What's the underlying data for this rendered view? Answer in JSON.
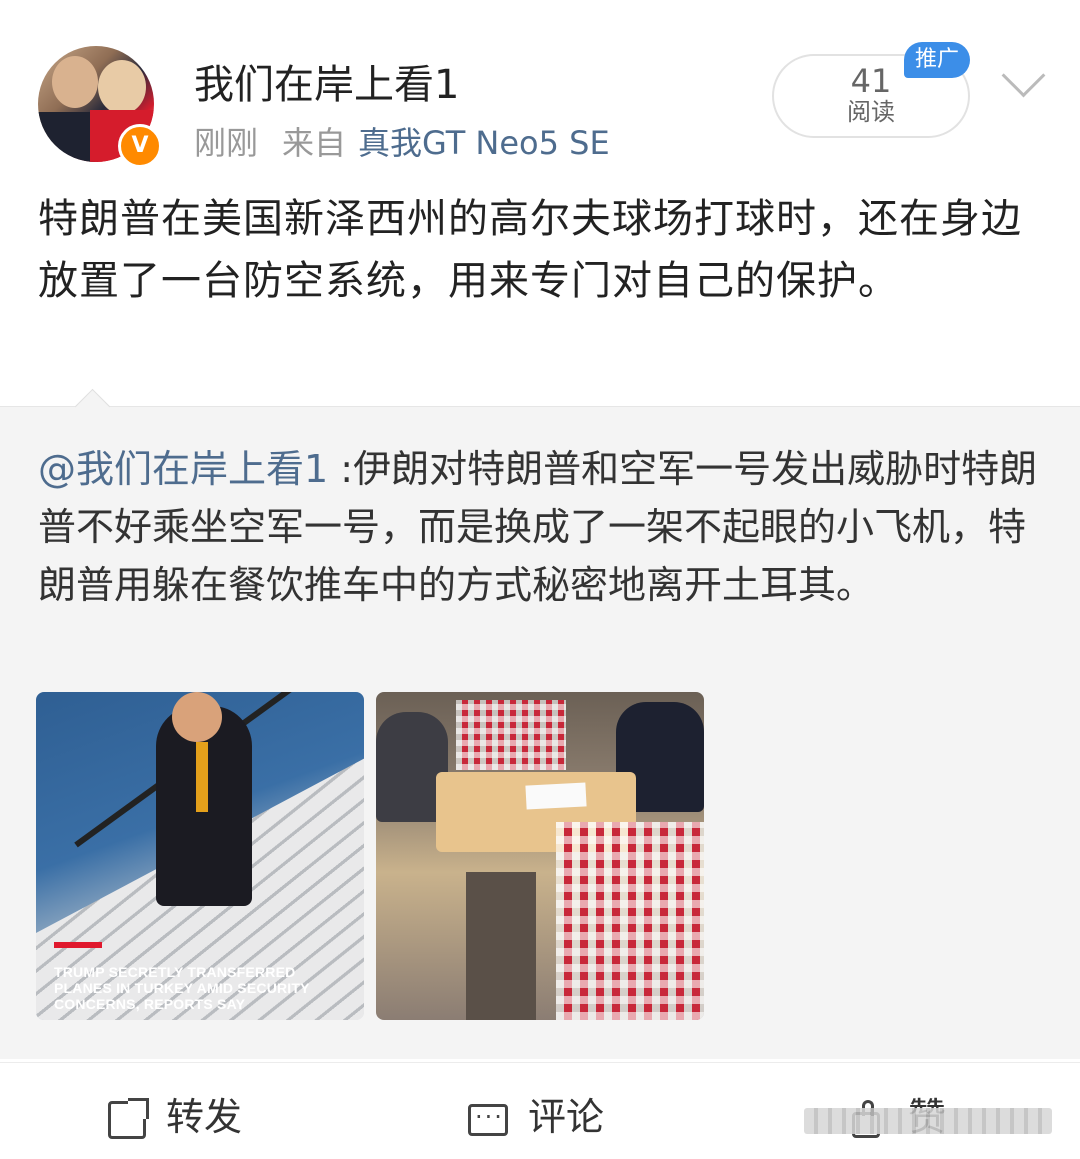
{
  "post": {
    "username": "我们在岸上看1",
    "time": "刚刚",
    "source_prefix": "来自",
    "device": "真我GT Neo5 SE",
    "read_count": "41",
    "read_label": "阅读",
    "promo_badge": "推广",
    "text": "特朗普在美国新泽西州的高尔夫球场打球时，还在身边放置了一台防空系统，用来专门对自己的保护。"
  },
  "repost": {
    "mention": "@我们在岸上看1",
    "text": " :伊朗对特朗普和空军一号发出威胁时特朗普不好乘坐空军一号，而是换成了一架不起眼的小飞机，特朗普用躲在餐饮推车中的方式秘密地离开土耳其。",
    "images": [
      {
        "caption": "TRUMP SECRETLY TRANSFERRED PLANES IN TURKEY AMID SECURITY CONCERNS, REPORTS SAY"
      },
      {
        "caption": ""
      }
    ]
  },
  "actions": {
    "forward": "转发",
    "comment": "评论",
    "like": "赞"
  },
  "colors": {
    "link": "#4e6c8e",
    "promo": "#3c8ee8",
    "verified": "#ff8a00"
  }
}
